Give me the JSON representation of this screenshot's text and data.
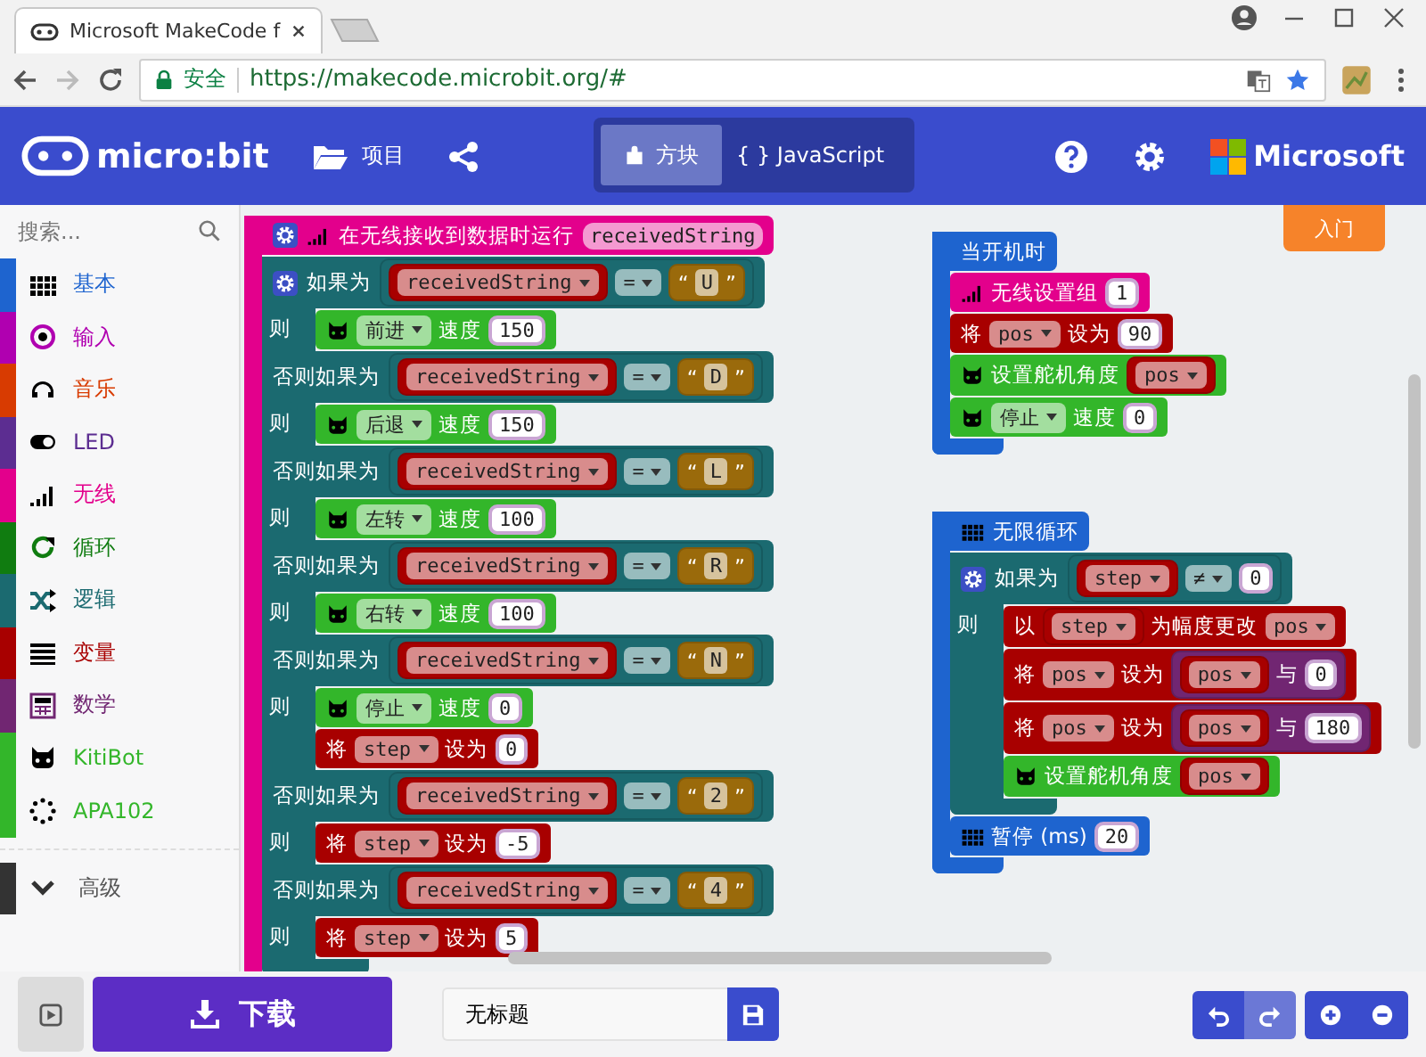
{
  "browser": {
    "tab_title": "Microsoft MakeCode f",
    "secure_label": "安全",
    "url": "https://makecode.microbit.org/#"
  },
  "header": {
    "logo": "micro:bit",
    "projects": "项目",
    "modes": [
      {
        "label": "方块",
        "selected": true
      },
      {
        "label": "{ } JavaScript",
        "selected": false
      }
    ],
    "brand": "Microsoft"
  },
  "toolbox": {
    "search_placeholder": "搜索...",
    "categories": [
      {
        "label": "基本",
        "kind": "grid",
        "color": "#1e64cf"
      },
      {
        "label": "输入",
        "kind": "target",
        "color": "#b000b0"
      },
      {
        "label": "音乐",
        "kind": "headphones",
        "color": "#d83b01"
      },
      {
        "label": "LED",
        "kind": "toggle",
        "color": "#5c2d91"
      },
      {
        "label": "无线",
        "kind": "signal",
        "color": "#e3008c"
      },
      {
        "label": "循环",
        "kind": "refresh",
        "color": "#107c10"
      },
      {
        "label": "逻辑",
        "kind": "shuffle",
        "color": "#1b6a70"
      },
      {
        "label": "变量",
        "kind": "lines",
        "color": "#a80000"
      },
      {
        "label": "数学",
        "kind": "calculator",
        "color": "#712672"
      },
      {
        "label": "KitiBot",
        "kind": "robot",
        "color": "#33b62a"
      },
      {
        "label": "APA102",
        "kind": "dots",
        "color": "#33b62a"
      }
    ],
    "advanced": {
      "label": "高级",
      "kind": "chevron",
      "color": "#333333"
    }
  },
  "workspace": {
    "tutorial_button": "入门",
    "stacks": [
      {
        "kind": "hat",
        "color": "#e3008c",
        "parts": [
          {
            "kind": "gear"
          },
          {
            "kind": "signal"
          },
          {
            "kind": "text",
            "text": "在无线接收到数据时运行"
          },
          {
            "kind": "param",
            "text": "receivedString"
          }
        ],
        "body": [
          {
            "kind": "if",
            "color": "#1b6a70",
            "clauses": [
              {
                "parts": [
                  {
                    "kind": "gear"
                  },
                  {
                    "kind": "text",
                    "text": "如果为"
                  },
                  {
                    "kind": "reporter",
                    "color": "#1b6a70",
                    "parts": [
                      {
                        "kind": "reporter",
                        "color": "#a80000",
                        "parts": [
                          {
                            "kind": "dropdown",
                            "text": "receivedString"
                          }
                        ]
                      },
                      {
                        "kind": "dropdown",
                        "text": "="
                      },
                      {
                        "kind": "reporter",
                        "color": "#9a6a0b",
                        "parts": [
                          {
                            "kind": "text",
                            "text": "“"
                          },
                          {
                            "kind": "field",
                            "text": "U"
                          },
                          {
                            "kind": "text",
                            "text": "”"
                          }
                        ]
                      }
                    ]
                  }
                ],
                "then": "则",
                "body": [
                  {
                    "kind": "statement",
                    "color": "#33b62a",
                    "parts": [
                      {
                        "kind": "robot"
                      },
                      {
                        "kind": "dropdown",
                        "text": "前进"
                      },
                      {
                        "kind": "text",
                        "text": "速度"
                      },
                      {
                        "kind": "number",
                        "text": "150"
                      }
                    ]
                  }
                ]
              },
              {
                "parts": [
                  {
                    "kind": "text",
                    "text": "否则如果为"
                  },
                  {
                    "kind": "reporter",
                    "color": "#1b6a70",
                    "parts": [
                      {
                        "kind": "reporter",
                        "color": "#a80000",
                        "parts": [
                          {
                            "kind": "dropdown",
                            "text": "receivedString"
                          }
                        ]
                      },
                      {
                        "kind": "dropdown",
                        "text": "="
                      },
                      {
                        "kind": "reporter",
                        "color": "#9a6a0b",
                        "parts": [
                          {
                            "kind": "text",
                            "text": "“"
                          },
                          {
                            "kind": "field",
                            "text": "D"
                          },
                          {
                            "kind": "text",
                            "text": "”"
                          }
                        ]
                      }
                    ]
                  }
                ],
                "then": "则",
                "body": [
                  {
                    "kind": "statement",
                    "color": "#33b62a",
                    "parts": [
                      {
                        "kind": "robot"
                      },
                      {
                        "kind": "dropdown",
                        "text": "后退"
                      },
                      {
                        "kind": "text",
                        "text": "速度"
                      },
                      {
                        "kind": "number",
                        "text": "150"
                      }
                    ]
                  }
                ]
              },
              {
                "parts": [
                  {
                    "kind": "text",
                    "text": "否则如果为"
                  },
                  {
                    "kind": "reporter",
                    "color": "#1b6a70",
                    "parts": [
                      {
                        "kind": "reporter",
                        "color": "#a80000",
                        "parts": [
                          {
                            "kind": "dropdown",
                            "text": "receivedString"
                          }
                        ]
                      },
                      {
                        "kind": "dropdown",
                        "text": "="
                      },
                      {
                        "kind": "reporter",
                        "color": "#9a6a0b",
                        "parts": [
                          {
                            "kind": "text",
                            "text": "“"
                          },
                          {
                            "kind": "field",
                            "text": "L"
                          },
                          {
                            "kind": "text",
                            "text": "”"
                          }
                        ]
                      }
                    ]
                  }
                ],
                "then": "则",
                "body": [
                  {
                    "kind": "statement",
                    "color": "#33b62a",
                    "parts": [
                      {
                        "kind": "robot"
                      },
                      {
                        "kind": "dropdown",
                        "text": "左转"
                      },
                      {
                        "kind": "text",
                        "text": "速度"
                      },
                      {
                        "kind": "number",
                        "text": "100"
                      }
                    ]
                  }
                ]
              },
              {
                "parts": [
                  {
                    "kind": "text",
                    "text": "否则如果为"
                  },
                  {
                    "kind": "reporter",
                    "color": "#1b6a70",
                    "parts": [
                      {
                        "kind": "reporter",
                        "color": "#a80000",
                        "parts": [
                          {
                            "kind": "dropdown",
                            "text": "receivedString"
                          }
                        ]
                      },
                      {
                        "kind": "dropdown",
                        "text": "="
                      },
                      {
                        "kind": "reporter",
                        "color": "#9a6a0b",
                        "parts": [
                          {
                            "kind": "text",
                            "text": "“"
                          },
                          {
                            "kind": "field",
                            "text": "R"
                          },
                          {
                            "kind": "text",
                            "text": "”"
                          }
                        ]
                      }
                    ]
                  }
                ],
                "then": "则",
                "body": [
                  {
                    "kind": "statement",
                    "color": "#33b62a",
                    "parts": [
                      {
                        "kind": "robot"
                      },
                      {
                        "kind": "dropdown",
                        "text": "右转"
                      },
                      {
                        "kind": "text",
                        "text": "速度"
                      },
                      {
                        "kind": "number",
                        "text": "100"
                      }
                    ]
                  }
                ]
              },
              {
                "parts": [
                  {
                    "kind": "text",
                    "text": "否则如果为"
                  },
                  {
                    "kind": "reporter",
                    "color": "#1b6a70",
                    "parts": [
                      {
                        "kind": "reporter",
                        "color": "#a80000",
                        "parts": [
                          {
                            "kind": "dropdown",
                            "text": "receivedString"
                          }
                        ]
                      },
                      {
                        "kind": "dropdown",
                        "text": "="
                      },
                      {
                        "kind": "reporter",
                        "color": "#9a6a0b",
                        "parts": [
                          {
                            "kind": "text",
                            "text": "“"
                          },
                          {
                            "kind": "field",
                            "text": "N"
                          },
                          {
                            "kind": "text",
                            "text": "”"
                          }
                        ]
                      }
                    ]
                  }
                ],
                "then": "则",
                "body": [
                  {
                    "kind": "statement",
                    "color": "#33b62a",
                    "parts": [
                      {
                        "kind": "robot"
                      },
                      {
                        "kind": "dropdown",
                        "text": "停止"
                      },
                      {
                        "kind": "text",
                        "text": "速度"
                      },
                      {
                        "kind": "number",
                        "text": "0"
                      }
                    ]
                  },
                  {
                    "kind": "statement",
                    "color": "#a80000",
                    "parts": [
                      {
                        "kind": "text",
                        "text": "将"
                      },
                      {
                        "kind": "dropdown",
                        "text": "step"
                      },
                      {
                        "kind": "text",
                        "text": "设为"
                      },
                      {
                        "kind": "number",
                        "text": "0"
                      }
                    ]
                  }
                ]
              },
              {
                "parts": [
                  {
                    "kind": "text",
                    "text": "否则如果为"
                  },
                  {
                    "kind": "reporter",
                    "color": "#1b6a70",
                    "parts": [
                      {
                        "kind": "reporter",
                        "color": "#a80000",
                        "parts": [
                          {
                            "kind": "dropdown",
                            "text": "receivedString"
                          }
                        ]
                      },
                      {
                        "kind": "dropdown",
                        "text": "="
                      },
                      {
                        "kind": "reporter",
                        "color": "#9a6a0b",
                        "parts": [
                          {
                            "kind": "text",
                            "text": "“"
                          },
                          {
                            "kind": "field",
                            "text": "2"
                          },
                          {
                            "kind": "text",
                            "text": "”"
                          }
                        ]
                      }
                    ]
                  }
                ],
                "then": "则",
                "body": [
                  {
                    "kind": "statement",
                    "color": "#a80000",
                    "parts": [
                      {
                        "kind": "text",
                        "text": "将"
                      },
                      {
                        "kind": "dropdown",
                        "text": "step"
                      },
                      {
                        "kind": "text",
                        "text": "设为"
                      },
                      {
                        "kind": "number",
                        "text": "-5"
                      }
                    ]
                  }
                ]
              },
              {
                "parts": [
                  {
                    "kind": "text",
                    "text": "否则如果为"
                  },
                  {
                    "kind": "reporter",
                    "color": "#1b6a70",
                    "parts": [
                      {
                        "kind": "reporter",
                        "color": "#a80000",
                        "parts": [
                          {
                            "kind": "dropdown",
                            "text": "receivedString"
                          }
                        ]
                      },
                      {
                        "kind": "dropdown",
                        "text": "="
                      },
                      {
                        "kind": "reporter",
                        "color": "#9a6a0b",
                        "parts": [
                          {
                            "kind": "text",
                            "text": "“"
                          },
                          {
                            "kind": "field",
                            "text": "4"
                          },
                          {
                            "kind": "text",
                            "text": "”"
                          }
                        ]
                      }
                    ]
                  }
                ],
                "then": "则",
                "body": [
                  {
                    "kind": "statement",
                    "color": "#a80000",
                    "parts": [
                      {
                        "kind": "text",
                        "text": "将"
                      },
                      {
                        "kind": "dropdown",
                        "text": "step"
                      },
                      {
                        "kind": "text",
                        "text": "设为"
                      },
                      {
                        "kind": "number",
                        "text": "5"
                      }
                    ]
                  }
                ]
              }
            ]
          }
        ]
      },
      {
        "kind": "hat",
        "color": "#1e64cf",
        "parts": [
          {
            "kind": "text",
            "text": "当开机时"
          }
        ],
        "body": [
          {
            "kind": "statement",
            "color": "#e3008c",
            "parts": [
              {
                "kind": "signal"
              },
              {
                "kind": "text",
                "text": "无线设置组"
              },
              {
                "kind": "number",
                "text": "1"
              }
            ]
          },
          {
            "kind": "statement",
            "color": "#a80000",
            "parts": [
              {
                "kind": "text",
                "text": "将"
              },
              {
                "kind": "dropdown",
                "text": "pos"
              },
              {
                "kind": "text",
                "text": "设为"
              },
              {
                "kind": "number",
                "text": "90"
              }
            ]
          },
          {
            "kind": "statement",
            "color": "#33b62a",
            "parts": [
              {
                "kind": "robot"
              },
              {
                "kind": "text",
                "text": "设置舵机角度"
              },
              {
                "kind": "reporter",
                "color": "#a80000",
                "parts": [
                  {
                    "kind": "dropdown",
                    "text": "pos"
                  }
                ]
              }
            ]
          },
          {
            "kind": "statement",
            "color": "#33b62a",
            "parts": [
              {
                "kind": "robot"
              },
              {
                "kind": "dropdown",
                "text": "停止"
              },
              {
                "kind": "text",
                "text": "速度"
              },
              {
                "kind": "number",
                "text": "0"
              }
            ]
          }
        ]
      },
      {
        "kind": "hat",
        "color": "#1e64cf",
        "parts": [
          {
            "kind": "grid"
          },
          {
            "kind": "text",
            "text": "无限循环"
          }
        ],
        "body": [
          {
            "kind": "if",
            "color": "#1b6a70",
            "clauses": [
              {
                "parts": [
                  {
                    "kind": "gear"
                  },
                  {
                    "kind": "text",
                    "text": "如果为"
                  },
                  {
                    "kind": "reporter",
                    "color": "#1b6a70",
                    "parts": [
                      {
                        "kind": "reporter",
                        "color": "#a80000",
                        "parts": [
                          {
                            "kind": "dropdown",
                            "text": "step"
                          }
                        ]
                      },
                      {
                        "kind": "dropdown",
                        "text": "≠"
                      },
                      {
                        "kind": "number",
                        "text": "0"
                      }
                    ]
                  }
                ],
                "then": "则",
                "body": [
                  {
                    "kind": "statement",
                    "color": "#a80000",
                    "parts": [
                      {
                        "kind": "text",
                        "text": "以"
                      },
                      {
                        "kind": "reporter",
                        "color": "#a80000",
                        "parts": [
                          {
                            "kind": "dropdown",
                            "text": "step"
                          }
                        ]
                      },
                      {
                        "kind": "text",
                        "text": "为幅度更改"
                      },
                      {
                        "kind": "dropdown",
                        "text": "pos"
                      }
                    ]
                  },
                  {
                    "kind": "statement",
                    "color": "#a80000",
                    "parts": [
                      {
                        "kind": "text",
                        "text": "将"
                      },
                      {
                        "kind": "dropdown",
                        "text": "pos"
                      },
                      {
                        "kind": "text",
                        "text": "设为"
                      },
                      {
                        "kind": "reporter",
                        "color": "#712672",
                        "parts": [
                          {
                            "kind": "reporter",
                            "color": "#a80000",
                            "parts": [
                              {
                                "kind": "dropdown",
                                "text": "pos"
                              }
                            ]
                          },
                          {
                            "kind": "text",
                            "text": "与"
                          },
                          {
                            "kind": "number",
                            "text": "0"
                          }
                        ]
                      }
                    ]
                  },
                  {
                    "kind": "statement",
                    "color": "#a80000",
                    "parts": [
                      {
                        "kind": "text",
                        "text": "将"
                      },
                      {
                        "kind": "dropdown",
                        "text": "pos"
                      },
                      {
                        "kind": "text",
                        "text": "设为"
                      },
                      {
                        "kind": "reporter",
                        "color": "#712672",
                        "parts": [
                          {
                            "kind": "reporter",
                            "color": "#a80000",
                            "parts": [
                              {
                                "kind": "dropdown",
                                "text": "pos"
                              }
                            ]
                          },
                          {
                            "kind": "text",
                            "text": "与"
                          },
                          {
                            "kind": "number",
                            "text": "180"
                          }
                        ]
                      }
                    ]
                  },
                  {
                    "kind": "statement",
                    "color": "#33b62a",
                    "parts": [
                      {
                        "kind": "robot"
                      },
                      {
                        "kind": "text",
                        "text": "设置舵机角度"
                      },
                      {
                        "kind": "reporter",
                        "color": "#a80000",
                        "parts": [
                          {
                            "kind": "dropdown",
                            "text": "pos"
                          }
                        ]
                      }
                    ]
                  }
                ]
              }
            ]
          },
          {
            "kind": "statement",
            "color": "#1e64cf",
            "parts": [
              {
                "kind": "grid"
              },
              {
                "kind": "text",
                "text": "暂停 (ms)"
              },
              {
                "kind": "number",
                "text": "20"
              }
            ]
          }
        ]
      }
    ]
  },
  "footer": {
    "download": "下载",
    "project_name": "无标题"
  }
}
